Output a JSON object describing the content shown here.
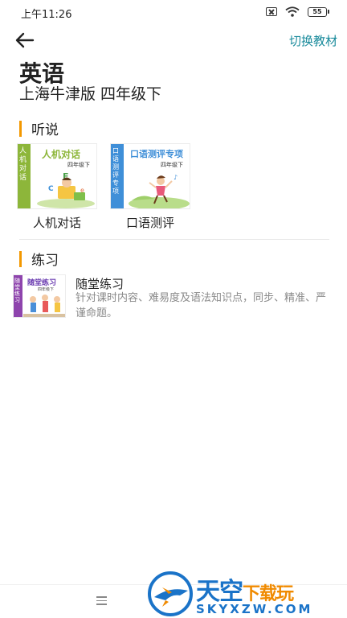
{
  "status_bar": {
    "time": "上午11:26",
    "battery": "55"
  },
  "header": {
    "switch_label": "切换教材"
  },
  "book": {
    "title": "英语",
    "edition": "上海牛津版  四年级下"
  },
  "sections": {
    "listening": {
      "title": "听说",
      "cards": [
        {
          "label": "人机对话",
          "spine_text": "人机对话",
          "cover_title": "人机对话",
          "cover_grade": "四年级下",
          "spine_color": "#8db63a"
        },
        {
          "label": "口语测评",
          "spine_text": "口语测评专项",
          "cover_title": "口语测评专项",
          "cover_grade": "四年级下",
          "spine_color": "#3f8fd8"
        }
      ]
    },
    "practice": {
      "title": "练习",
      "items": [
        {
          "title": "随堂练习",
          "description": "针对课时内容、难易度及语法知识点，同步、精准、严谨命题。",
          "spine_text": "随堂练习",
          "cover_title": "随堂练习",
          "cover_grade": "四年级下"
        }
      ]
    }
  },
  "watermark": {
    "name_part1": "天空",
    "name_part2": "下载玩",
    "domain": "SKYXZW.COM"
  },
  "colors": {
    "accent": "#1a8b9c",
    "section_bar": "#f39800"
  }
}
